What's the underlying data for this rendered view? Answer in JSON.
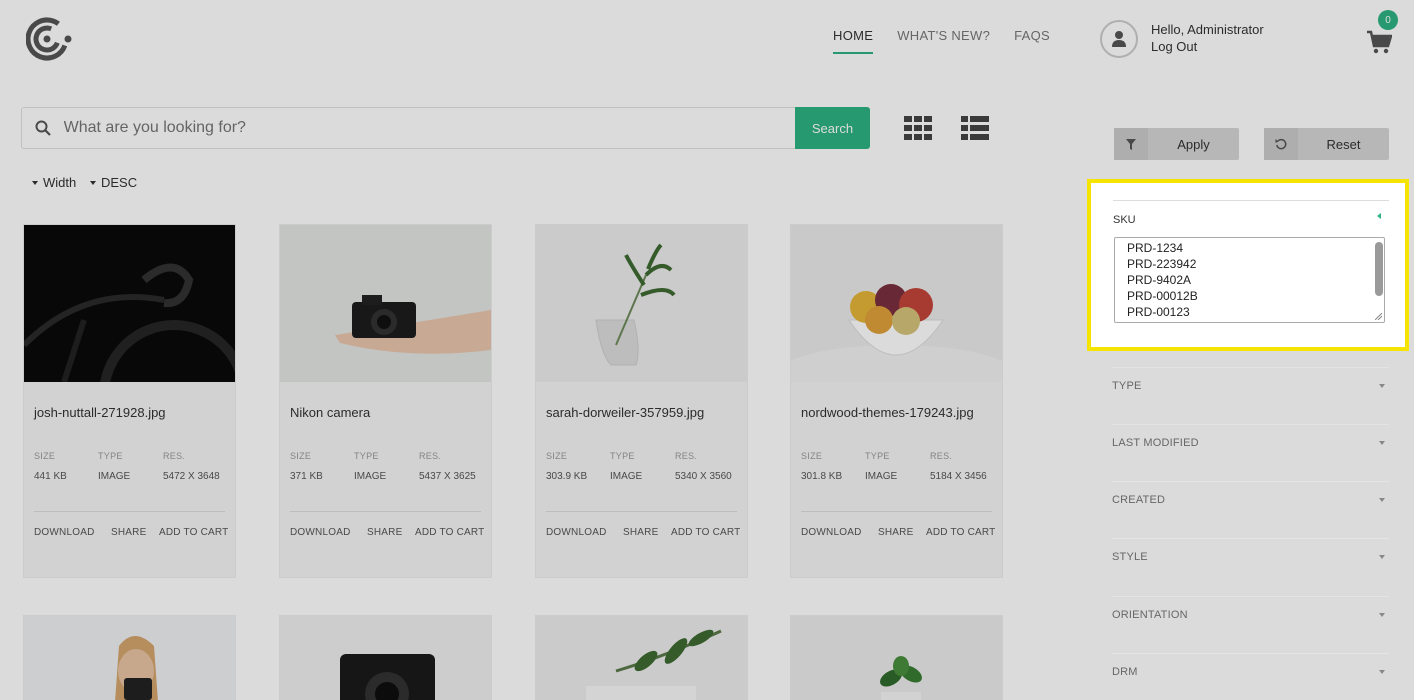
{
  "nav": {
    "home": "HOME",
    "whats_new": "WHAT'S NEW?",
    "faqs": "FAQS"
  },
  "search": {
    "placeholder": "What are you looking for?",
    "button": "Search"
  },
  "sort": {
    "field": "Width",
    "order": "DESC"
  },
  "meta_labels": {
    "size": "SIZE",
    "type": "TYPE",
    "res": "RES."
  },
  "actions": {
    "download": "DOWNLOAD",
    "share": "SHARE",
    "add_to_cart": "ADD TO CART"
  },
  "cards": [
    {
      "title": "josh-nuttall-271928.jpg",
      "size": "441 KB",
      "type": "IMAGE",
      "res": "5472 X 3648"
    },
    {
      "title": "Nikon camera",
      "size": "371 KB",
      "type": "IMAGE",
      "res": "5437 X 3625"
    },
    {
      "title": "sarah-dorweiler-357959.jpg",
      "size": "303.9 KB",
      "type": "IMAGE",
      "res": "5340 X 3560"
    },
    {
      "title": "nordwood-themes-179243.jpg",
      "size": "301.8 KB",
      "type": "IMAGE",
      "res": "5184 X 3456"
    }
  ],
  "user": {
    "greeting": "Hello, Administrator",
    "logout": "Log Out"
  },
  "cart": {
    "count": "0"
  },
  "filters": {
    "apply": "Apply",
    "reset": "Reset"
  },
  "sku": {
    "label": "SKU",
    "values": [
      "PRD-1234",
      "PRD-223942",
      "PRD-9402A",
      "PRD-00012B",
      "PRD-00123"
    ]
  },
  "facets": [
    "TYPE",
    "LAST MODIFIED",
    "CREATED",
    "STYLE",
    "ORIENTATION",
    "DRM"
  ],
  "colors": {
    "accent": "#2db383",
    "highlight": "#f5e400"
  }
}
